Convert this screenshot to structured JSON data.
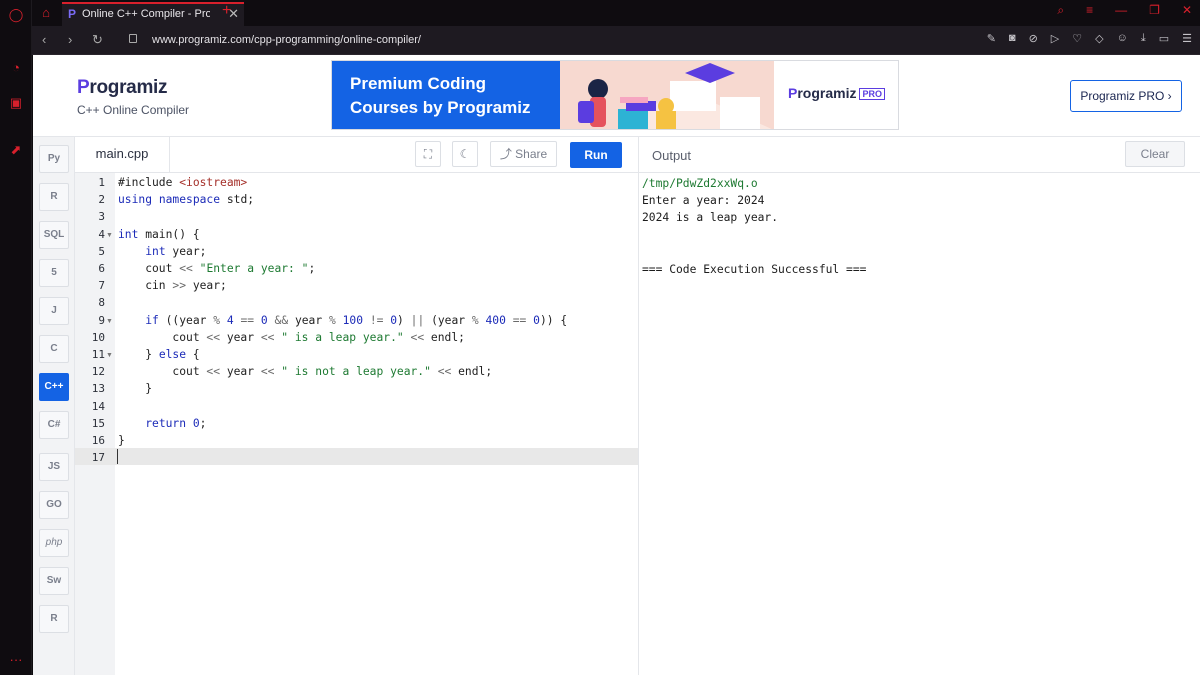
{
  "browser": {
    "tab_title": "Online C++ Compiler - Pro",
    "new_tab": "+",
    "url": "www.programiz.com/cpp-programming/online-compiler/"
  },
  "header": {
    "logo": "rogramiz",
    "logo_p": "P",
    "subtitle": "C++ Online Compiler",
    "pro_button": "Programiz PRO ›"
  },
  "banner": {
    "title_line1": "Premium Coding",
    "title_line2": "Courses by Programiz",
    "logo_p": "P",
    "logo": "rogramiz",
    "pro_tag": "PRO"
  },
  "languages": [
    "Py",
    "R",
    "SQL",
    "5",
    "J",
    "C",
    "C++",
    "C#",
    "JS",
    "GO",
    "php",
    "Sw",
    "R"
  ],
  "editor": {
    "file_name": "main.cpp",
    "share_label": "Share",
    "run_label": "Run",
    "line_numbers": [
      "1",
      "2",
      "3",
      "4",
      "5",
      "6",
      "7",
      "8",
      "9",
      "10",
      "11",
      "12",
      "13",
      "14",
      "15",
      "16",
      "17"
    ],
    "lines": [
      "#include <iostream>",
      "using namespace std;",
      "",
      "int main() {",
      "    int year;",
      "    cout << \"Enter a year: \";",
      "    cin >> year;",
      "",
      "    if ((year % 4 == 0 && year % 100 != 0) || (year % 400 == 0)) {",
      "        cout << year << \" is a leap year.\" << endl;",
      "    } else {",
      "        cout << year << \" is not a leap year.\" << endl;",
      "    }",
      "",
      "    return 0;",
      "}",
      ""
    ]
  },
  "output": {
    "title": "Output",
    "clear_label": "Clear",
    "lines": [
      "/tmp/PdwZd2xxWq.o",
      "Enter a year: 2024",
      "2024 is a leap year.",
      "",
      "",
      "=== Code Execution Successful ==="
    ]
  }
}
